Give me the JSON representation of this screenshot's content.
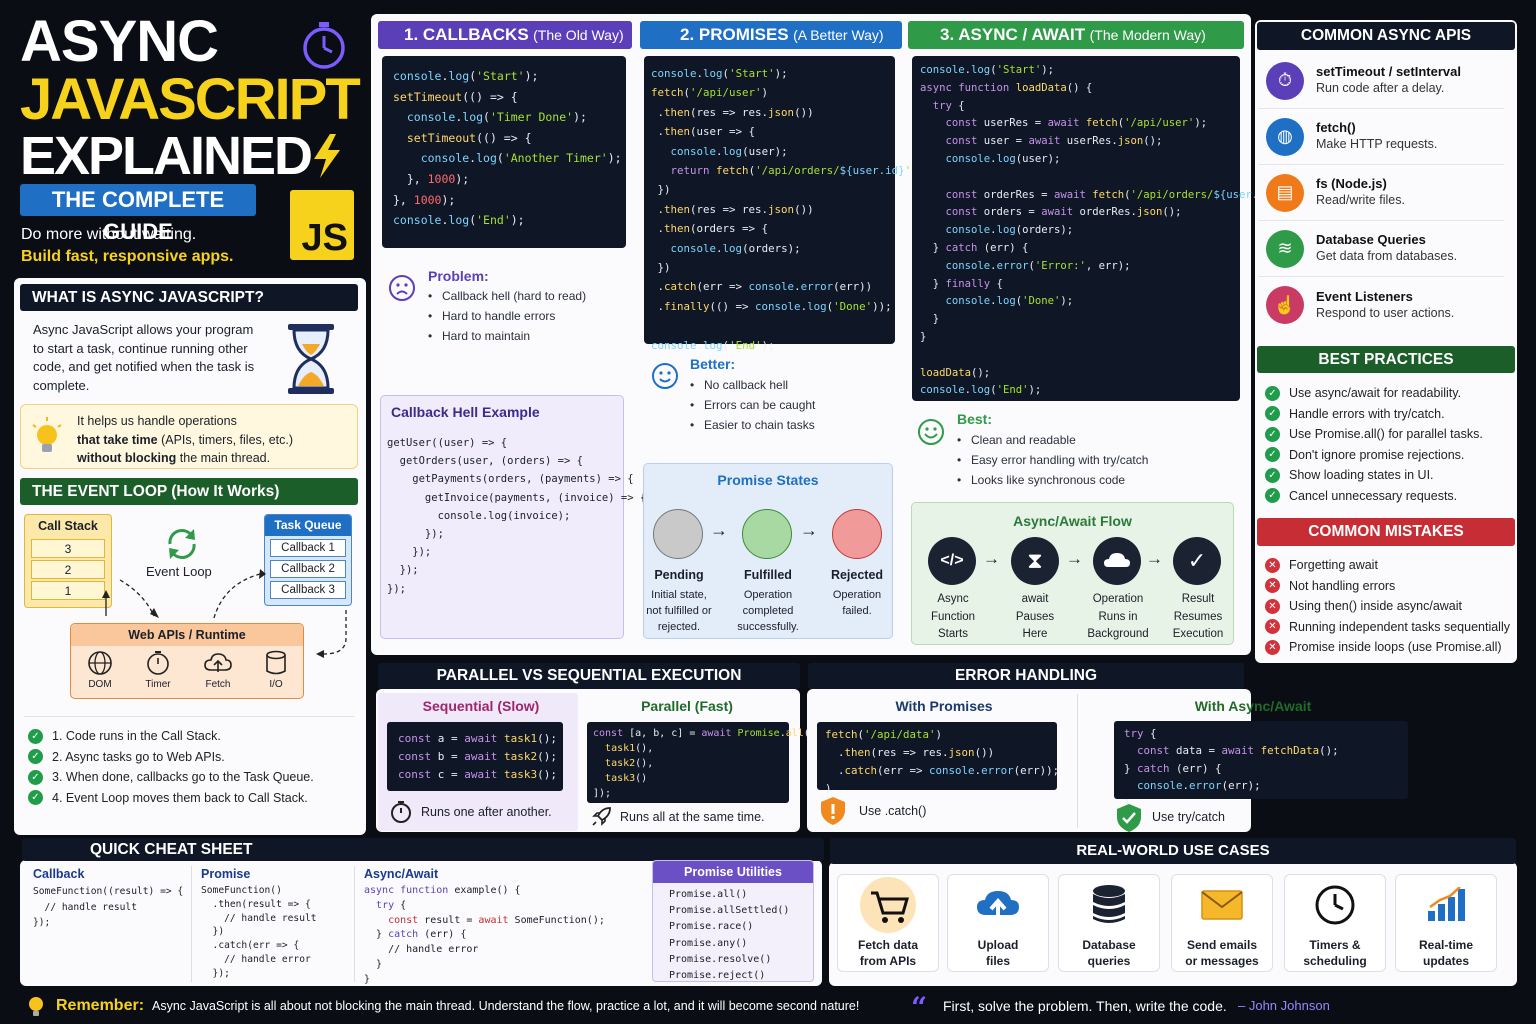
{
  "header": {
    "line1": "ASYNC",
    "line2": "JAVASCRIPT",
    "line3": "EXPLAINED",
    "badge": "THE COMPLETE GUIDE",
    "tag1": "Do more without waiting.",
    "tag2": "Build fast, responsive apps.",
    "js_logo": "JS"
  },
  "what_is": {
    "title": "WHAT IS ASYNC JAVASCRIPT?",
    "body": "Async JavaScript allows your program to start a task, continue running other code, and get notified when the task is complete.",
    "tip_a": "It helps us handle operations",
    "tip_b1": "that take time",
    "tip_b2": " (APIs, timers, files, etc.)",
    "tip_c1": "without blocking",
    "tip_c2": " the main thread."
  },
  "event_loop": {
    "title": "THE EVENT LOOP (How It Works)",
    "call_stack": "Call Stack",
    "stack_items": [
      "3",
      "2",
      "1"
    ],
    "loop_label": "Event Loop",
    "task_queue": "Task Queue",
    "queue_items": [
      "Callback 1",
      "Callback 2",
      "Callback 3"
    ],
    "web_apis": "Web APIs / Runtime",
    "apis": [
      "DOM",
      "Timer",
      "Fetch",
      "I/O"
    ],
    "steps": [
      "1.  Code runs in the Call Stack.",
      "2.  Async tasks go to Web APIs.",
      "3.  When done, callbacks go to the Task Queue.",
      "4.  Event Loop moves them back to Call Stack."
    ]
  },
  "callbacks": {
    "title": "1. CALLBACKS",
    "subtitle": "(The Old Way)",
    "problem_title": "Problem:",
    "problems": [
      "Callback hell (hard to read)",
      "Hard to handle errors",
      "Hard to maintain"
    ],
    "hell_title": "Callback Hell Example"
  },
  "promises": {
    "title": "2. PROMISES",
    "subtitle": "(A Better Way)",
    "better_title": "Better:",
    "better": [
      "No callback hell",
      "Errors can be caught",
      "Easier to chain tasks"
    ],
    "states_title": "Promise States",
    "states": [
      {
        "name": "Pending",
        "desc": "Initial state, not fulfilled or rejected."
      },
      {
        "name": "Fulfilled",
        "desc": "Operation completed successfully."
      },
      {
        "name": "Rejected",
        "desc": "Operation failed."
      }
    ]
  },
  "async_await": {
    "title": "3. ASYNC / AWAIT",
    "subtitle": "(The Modern Way)",
    "best_title": "Best:",
    "best": [
      "Clean and readable",
      "Easy error handling with try/catch",
      "Looks like synchronous code"
    ],
    "flow_title": "Async/Await Flow",
    "flow": [
      "Async Function Starts",
      "await Pauses Here",
      "Operation Runs in Background",
      "Result Resumes Execution"
    ]
  },
  "common_apis": {
    "title": "COMMON ASYNC APIS",
    "items": [
      {
        "name": "setTimeout / setInterval",
        "desc": "Run code after a delay.",
        "color": "#5b3fb8"
      },
      {
        "name": "fetch()",
        "desc": "Make HTTP requests.",
        "color": "#1f6fc4"
      },
      {
        "name": "fs (Node.js)",
        "desc": "Read/write files.",
        "color": "#f07a1a"
      },
      {
        "name": "Database Queries",
        "desc": "Get data from databases.",
        "color": "#2f9a48"
      },
      {
        "name": "Event Listeners",
        "desc": "Respond to user actions.",
        "color": "#c93a64"
      }
    ]
  },
  "best_practices": {
    "title": "BEST PRACTICES",
    "items": [
      "Use async/await for readability.",
      "Handle errors with try/catch.",
      "Use Promise.all() for parallel tasks.",
      "Don't ignore promise rejections.",
      "Show loading states in UI.",
      "Cancel unnecessary requests."
    ]
  },
  "mistakes": {
    "title": "COMMON MISTAKES",
    "items": [
      "Forgetting await",
      "Not handling errors",
      "Using then() inside async/await",
      "Running independent tasks sequentially",
      "Promise inside loops (use Promise.all)"
    ]
  },
  "parallel": {
    "title": "PARALLEL VS SEQUENTIAL EXECUTION",
    "seq_title": "Sequential (Slow)",
    "par_title": "Parallel (Fast)",
    "seq_note": "Runs one after another.",
    "par_note": "Runs all at the same time."
  },
  "errors": {
    "title": "ERROR HANDLING",
    "p_title": "With Promises",
    "a_title": "With Async/Await",
    "p_note": "Use .catch()",
    "a_note": "Use try/catch"
  },
  "cheat": {
    "title": "QUICK CHEAT SHEET",
    "cb": "Callback",
    "pr": "Promise",
    "aa": "Async/Await",
    "util_title": "Promise Utilities",
    "utils": [
      "Promise.all()",
      "Promise.allSettled()",
      "Promise.race()",
      "Promise.any()",
      "Promise.resolve()",
      "Promise.reject()"
    ]
  },
  "use_cases": {
    "title": "REAL-WORLD USE CASES",
    "items": [
      {
        "l1": "Fetch data",
        "l2": "from APIs"
      },
      {
        "l1": "Upload",
        "l2": "files"
      },
      {
        "l1": "Database",
        "l2": "queries"
      },
      {
        "l1": "Send emails",
        "l2": "or messages"
      },
      {
        "l1": "Timers &",
        "l2": "scheduling"
      },
      {
        "l1": "Real-time",
        "l2": "updates"
      }
    ]
  },
  "footer": {
    "remember": "Remember:",
    "remember_text": "Async JavaScript is all about not blocking the main thread. Understand the flow, practice a lot, and it will become second nature!",
    "quote": "First, solve the problem. Then, write the code.",
    "author": "– John Johnson"
  },
  "colors": {
    "yellow": "#f7d21c",
    "purple": "#5b3fb8",
    "blue": "#1f6fc4",
    "green": "#2f9a48",
    "red": "#d2333b",
    "navy": "#0f1626"
  }
}
